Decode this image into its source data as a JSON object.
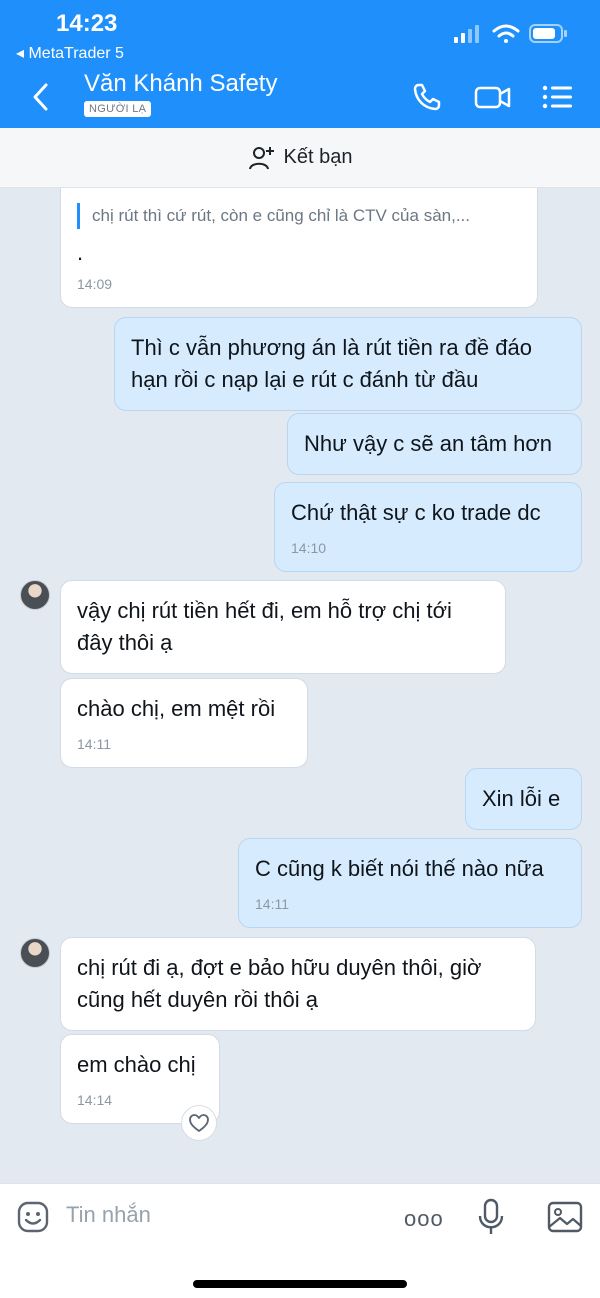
{
  "status_bar": {
    "time": "14:23",
    "back_app": "◂ MetaTrader 5"
  },
  "header": {
    "name": "Văn Khánh Safety",
    "badge": "NGƯỜI LẠ"
  },
  "add_friend": {
    "label": "Kết bạn"
  },
  "messages": [
    {
      "dir": "in",
      "quote": "chị rút thì cứ rút, còn e cũng chỉ là CTV của sàn,...",
      "text": ".",
      "time": "14:09"
    },
    {
      "dir": "out",
      "text": "Thì c vẫn phương án là rút tiền ra đề đáo hạn rồi c nạp lại e rút c đánh từ đầu"
    },
    {
      "dir": "out",
      "text": "Như vậy c sẽ an tâm hơn"
    },
    {
      "dir": "out",
      "text": "Chứ thật sự c ko trade dc",
      "time": "14:10"
    },
    {
      "dir": "in",
      "text": "vậy chị rút tiền hết đi, em hỗ trợ chị tới đây thôi ạ"
    },
    {
      "dir": "in",
      "text": "chào chị, em mệt rồi",
      "time": "14:11"
    },
    {
      "dir": "out",
      "text": "Xin lỗi e"
    },
    {
      "dir": "out",
      "text": "C cũng k biết nói thế nào nữa",
      "time": "14:11"
    },
    {
      "dir": "in",
      "text": "chị rút đi ạ, đợt e bảo hữu duyên thôi, giờ cũng hết duyên rồi thôi ạ"
    },
    {
      "dir": "in",
      "text": "em chào chị",
      "time": "14:14"
    }
  ],
  "composer": {
    "placeholder": "Tin nhắn",
    "more_label": "ooo"
  },
  "colors": {
    "header_bg": "#1f90fb",
    "outgoing_bg": "#d6ecfe",
    "incoming_bg": "#ffffff",
    "chat_bg": "#e2e9f1"
  },
  "icons": [
    "back-icon",
    "phone-icon",
    "video-icon",
    "menu-icon",
    "add-friend-icon",
    "heart-icon",
    "sticker-icon",
    "more-icon",
    "microphone-icon",
    "image-icon"
  ]
}
